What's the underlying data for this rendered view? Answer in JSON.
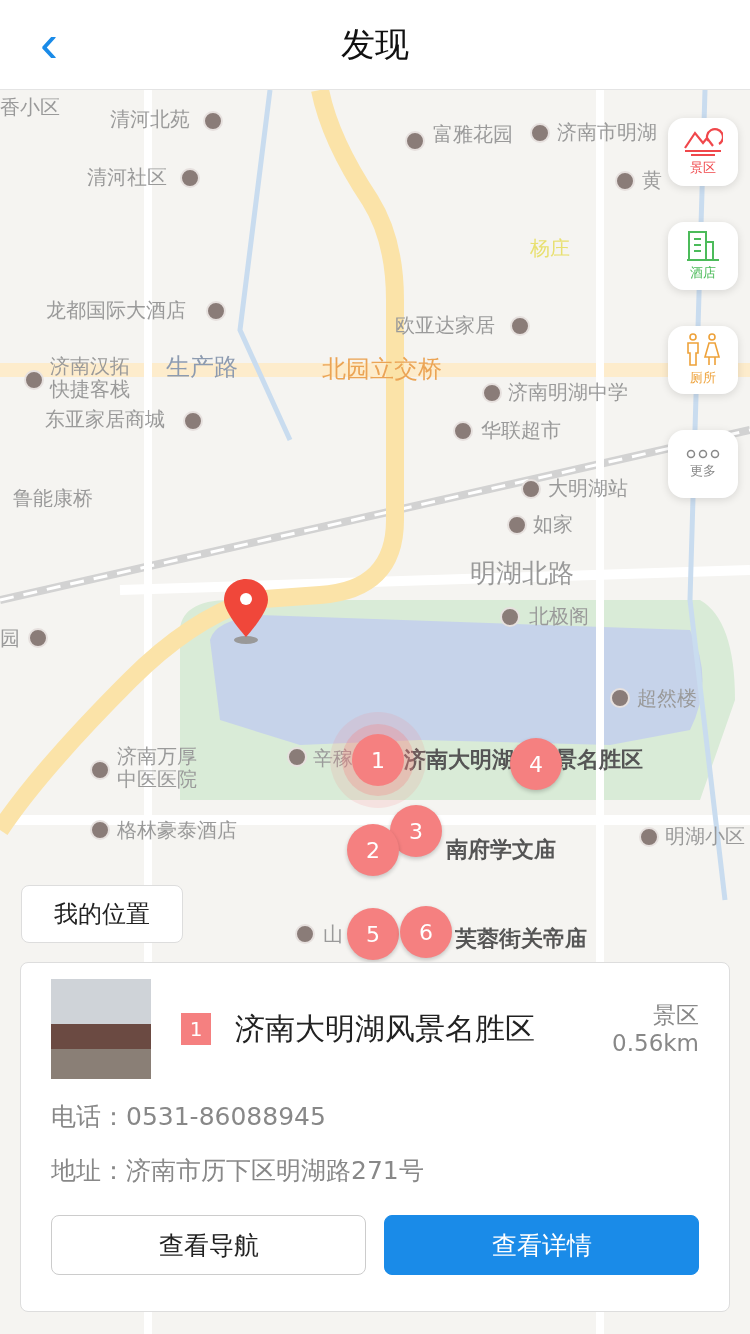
{
  "nav": {
    "back_icon": "‹",
    "title": "发现"
  },
  "map": {
    "labels": [
      {
        "kind": "poi",
        "text": "香小区"
      },
      {
        "kind": "poi",
        "text": "清河北苑"
      },
      {
        "kind": "poi",
        "text": "富雅花园"
      },
      {
        "kind": "poi",
        "text": "济南市明湖"
      },
      {
        "kind": "poi",
        "text": "清河社区"
      },
      {
        "kind": "poi",
        "text": "黄"
      },
      {
        "kind": "village",
        "text": "杨庄"
      },
      {
        "kind": "poi",
        "text": "龙都国际大酒店"
      },
      {
        "kind": "poi",
        "text": "欧亚达家居"
      },
      {
        "kind": "poi",
        "text": "济南汉拓快捷客栈"
      },
      {
        "kind": "road",
        "text": "生产路"
      },
      {
        "kind": "bridge",
        "text": "北园立交桥"
      },
      {
        "kind": "poi",
        "text": "济南明湖中学"
      },
      {
        "kind": "poi",
        "text": "东亚家居商城"
      },
      {
        "kind": "poi",
        "text": "华联超市"
      },
      {
        "kind": "poi",
        "text": "鲁能康桥"
      },
      {
        "kind": "poi",
        "text": "大明湖站"
      },
      {
        "kind": "poi",
        "text": "如家"
      },
      {
        "kind": "street",
        "text": "明湖北路"
      },
      {
        "kind": "poi",
        "text": "北极阁"
      },
      {
        "kind": "poi",
        "text": "园"
      },
      {
        "kind": "poi",
        "text": "超然楼"
      },
      {
        "kind": "poi",
        "text": "济南万厚中医医院"
      },
      {
        "kind": "poi",
        "text": "格林豪泰酒店"
      },
      {
        "kind": "poi",
        "text": "辛稼"
      },
      {
        "kind": "scenic",
        "text": "济南大明湖"
      },
      {
        "kind": "scenic",
        "text": "景名胜区"
      },
      {
        "kind": "poi",
        "text": "明湖小区"
      },
      {
        "kind": "scenic",
        "text": "南府学文庙"
      },
      {
        "kind": "poi",
        "text": "山"
      },
      {
        "kind": "scenic",
        "text": "芙蓉街关帝庙"
      }
    ],
    "markers": [
      {
        "number": "1",
        "selected": true
      },
      {
        "number": "4",
        "selected": false
      },
      {
        "number": "3",
        "selected": false
      },
      {
        "number": "2",
        "selected": false
      },
      {
        "number": "5",
        "selected": false
      },
      {
        "number": "6",
        "selected": false
      }
    ],
    "filters": [
      {
        "kind": "scenic",
        "label": "景区"
      },
      {
        "kind": "hotel",
        "label": "酒店"
      },
      {
        "kind": "toilet",
        "label": "厕所"
      },
      {
        "kind": "more",
        "label": "更多"
      }
    ],
    "my_location": "我的位置"
  },
  "card": {
    "badge": "1",
    "name": "济南大明湖风景名胜区",
    "category": "景区",
    "distance": "0.56km",
    "phone": "电话：0531-86088945",
    "address": "地址：济南市历下区明湖路271号",
    "buttons": [
      {
        "kind": "outline",
        "label": "查看导航"
      },
      {
        "kind": "primary",
        "label": "查看详情"
      }
    ]
  }
}
